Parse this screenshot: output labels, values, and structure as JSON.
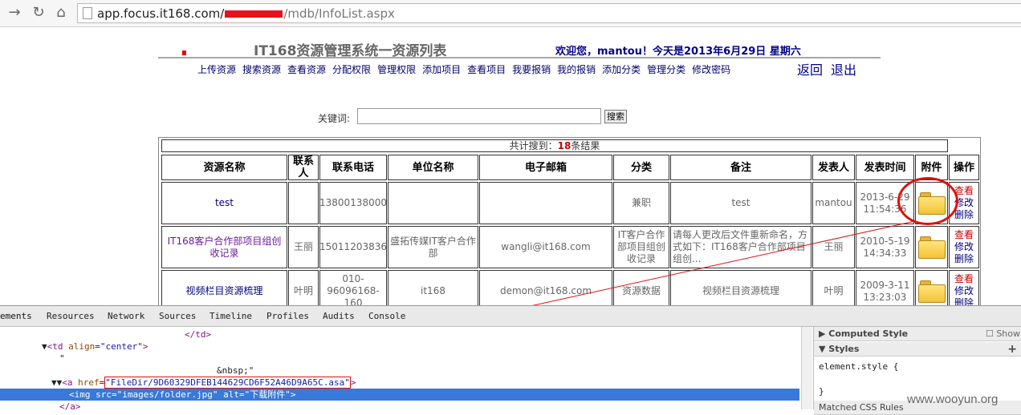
{
  "browser": {
    "url_host": "app.focus.it168.com/",
    "url_path": "/mdb/InfoList.aspx"
  },
  "page": {
    "title": "IT168资源管理系统一资源列表",
    "welcome": "欢迎您，mantou！今天是2013年6月29日 星期六",
    "nav": [
      "上传资源",
      "搜索资源",
      "查看资源",
      "分配权限",
      "管理权限",
      "添加项目",
      "查看项目",
      "我要报销",
      "我的报销",
      "添加分类",
      "管理分类",
      "修改密码"
    ],
    "back": "返回",
    "logout": "退出",
    "keyword_label": "关键词:",
    "search_button": "搜索",
    "count_prefix": "共计搜到：",
    "count": "18",
    "count_suffix": "条结果",
    "headers": [
      "资源名称",
      "联系人",
      "联系电话",
      "单位名称",
      "电子邮箱",
      "分类",
      "备注",
      "发表人",
      "发表时间",
      "附件",
      "操作"
    ],
    "rows": [
      {
        "name": "test",
        "contact": "",
        "phone": "13800138000",
        "company": "",
        "email": "",
        "category": "兼职",
        "note": "test",
        "author": "mantou",
        "time": "2013-6-29 11:54:36",
        "view": "查看",
        "edit": "修改",
        "del": "删除"
      },
      {
        "name": "IT168客户合作部项目组创收记录",
        "contact": "王丽",
        "phone": "15011203836",
        "company": "盛拓传媒IT客户合作部",
        "email": "wangli@it168.com",
        "category": "IT客户合作部项目组创收记录",
        "note": "请每人更改后文件重新命名，方式如下：IT168客户合作部项目组创...",
        "author": "王丽",
        "time": "2010-5-19 14:34:33",
        "view": "查看",
        "edit": "修改",
        "del": "删除"
      },
      {
        "name": "视频栏目资源梳理",
        "contact": "叶明",
        "phone": "010-96096168-160",
        "company": "it168",
        "email": "demon@it168.com",
        "category": "资源数据",
        "note": "视频栏目资源梳理",
        "author": "叶明",
        "time": "2009-3-11 13:23:03",
        "view": "查看",
        "edit": "修改",
        "del": "删除"
      }
    ]
  },
  "devtools": {
    "tabs": [
      "ements",
      "Resources",
      "Network",
      "Sources",
      "Timeline",
      "Profiles",
      "Audits",
      "Console"
    ],
    "lines": {
      "l0": "</td>",
      "l1_tag": "<td ",
      "l1_attr": "align",
      "l1_val": "\"center\"",
      "l2": "\"",
      "l3": "&nbsp;\"",
      "l4_attr": "href",
      "l4_val": "\"FileDir/9D60329DFEB144629CD6F52A46D9A65C.asa\"",
      "l5_attr1": "src",
      "l5_val1": "\"images/folder.jpg\"",
      "l5_attr2": "alt",
      "l5_val2": "\"下载附件\"",
      "l6": "</a>"
    },
    "computed_style": "Computed Style",
    "show_label": "Show",
    "styles": "Styles",
    "element_style": "element.style {",
    "close_brace": "}",
    "matched": "Matched CSS Rules"
  },
  "watermark": "www.wooyun.org",
  "colors": {
    "accent_red": "#e01010",
    "link_blue": "#00007a",
    "selection": "#3879d9"
  }
}
